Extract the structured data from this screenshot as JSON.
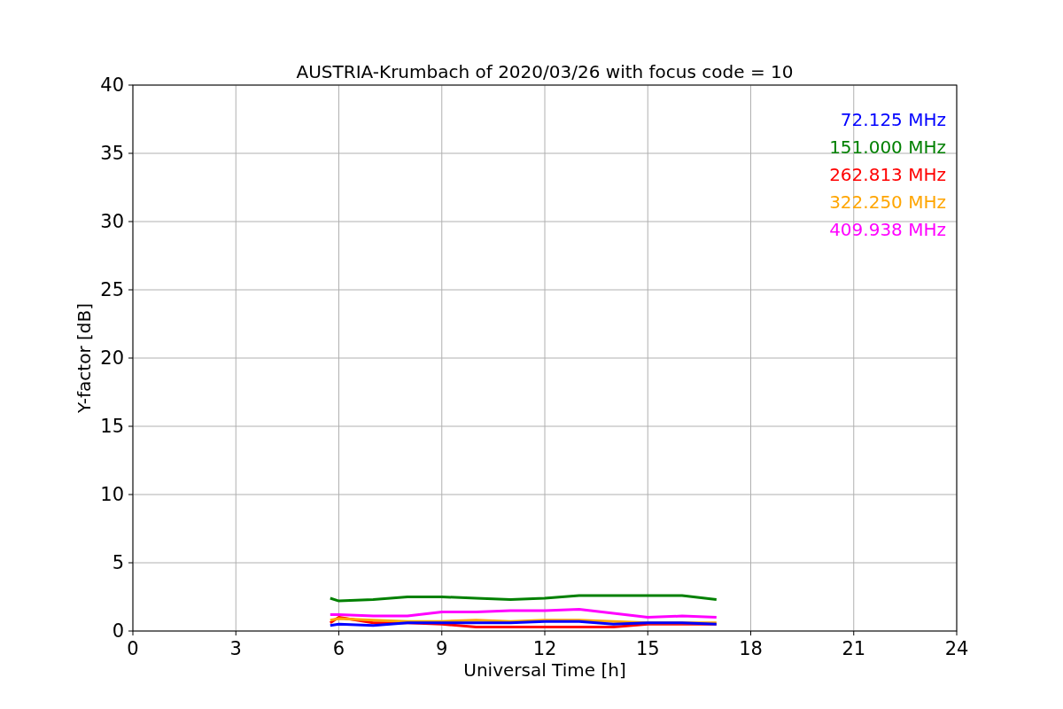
{
  "figure": {
    "chart_data": {
      "type": "line",
      "title": "AUSTRIA-Krumbach of 2020/03/26 with focus code = 10",
      "xlabel": "Universal Time [h]",
      "ylabel": "Y-factor [dB]",
      "x": [
        5.75,
        6,
        7,
        8,
        9,
        10,
        11,
        12,
        13,
        14,
        15,
        16,
        17
      ],
      "series": [
        {
          "name": "72.125 MHz",
          "color": "#0000ff",
          "values": [
            0.4,
            0.5,
            0.4,
            0.6,
            0.6,
            0.6,
            0.6,
            0.7,
            0.7,
            0.5,
            0.6,
            0.6,
            0.5
          ]
        },
        {
          "name": "151.000 MHz",
          "color": "#008000",
          "values": [
            2.4,
            2.2,
            2.3,
            2.5,
            2.5,
            2.4,
            2.3,
            2.4,
            2.6,
            2.6,
            2.6,
            2.6,
            2.3
          ]
        },
        {
          "name": "262.813 MHz",
          "color": "#ff0000",
          "values": [
            0.6,
            1.0,
            0.6,
            0.6,
            0.5,
            0.3,
            0.3,
            0.3,
            0.3,
            0.3,
            0.5,
            0.5,
            0.5
          ]
        },
        {
          "name": "322.250 MHz",
          "color": "#ffa500",
          "values": [
            0.8,
            0.9,
            0.8,
            0.7,
            0.7,
            0.8,
            0.7,
            0.8,
            0.8,
            0.7,
            0.6,
            0.6,
            0.6
          ]
        },
        {
          "name": "409.938 MHz",
          "color": "#ff00ff",
          "values": [
            1.2,
            1.2,
            1.1,
            1.1,
            1.4,
            1.4,
            1.5,
            1.5,
            1.6,
            1.3,
            1.0,
            1.1,
            1.0
          ]
        }
      ],
      "xlim": [
        0,
        24
      ],
      "ylim": [
        0,
        40
      ],
      "xticks": [
        0,
        3,
        6,
        9,
        12,
        15,
        18,
        21,
        24
      ],
      "yticks": [
        0,
        5,
        10,
        15,
        20,
        25,
        30,
        35,
        40
      ],
      "grid": true
    }
  }
}
